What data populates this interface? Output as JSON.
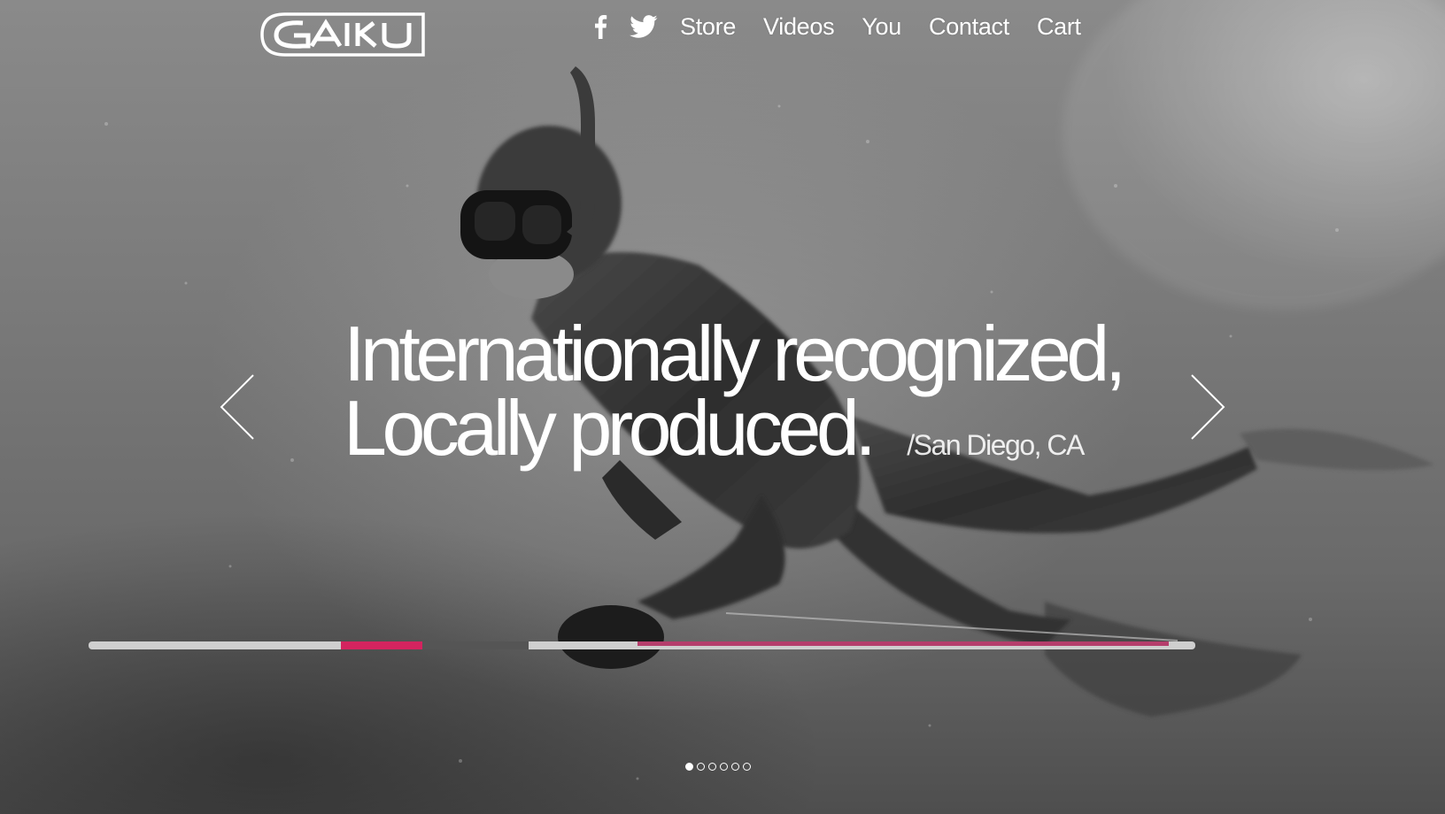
{
  "brand": {
    "logo_text": "GAIKU",
    "logo_icon": "gaiku-logo-icon"
  },
  "nav": {
    "social": [
      {
        "icon": "facebook-icon"
      },
      {
        "icon": "twitter-icon"
      }
    ],
    "links": [
      {
        "label": "Store"
      },
      {
        "label": "Videos"
      },
      {
        "label": "You"
      },
      {
        "label": "Contact"
      },
      {
        "label": "Cart"
      }
    ]
  },
  "hero": {
    "headline_line1": "Internationally recognized,",
    "headline_line2": "Locally produced.",
    "location": "/San Diego, CA",
    "prev_icon": "chevron-left-icon",
    "next_icon": "chevron-right-icon",
    "slide_count": 6,
    "active_slide": 1
  },
  "colors": {
    "text": "#ffffff",
    "spear_accent": "#d4245f",
    "background": "#7a7a7a"
  }
}
